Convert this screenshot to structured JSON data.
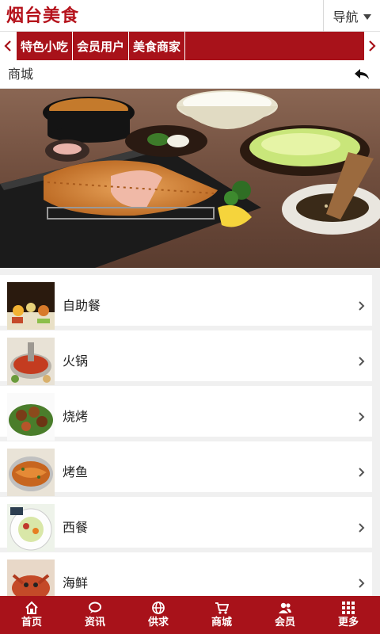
{
  "header": {
    "logo_text": "烟台美食",
    "nav_label": "导航"
  },
  "category_bar": {
    "items": [
      {
        "label": "特色小吃"
      },
      {
        "label": "会员用户"
      },
      {
        "label": "美食商家"
      }
    ]
  },
  "section": {
    "title": "商城"
  },
  "list": {
    "items": [
      {
        "label": "自助餐",
        "icon": "buffet-thumbnail"
      },
      {
        "label": "火锅",
        "icon": "hotpot-thumbnail"
      },
      {
        "label": "烧烤",
        "icon": "bbq-thumbnail"
      },
      {
        "label": "烤鱼",
        "icon": "grilled-fish-thumbnail"
      },
      {
        "label": "西餐",
        "icon": "western-food-thumbnail"
      },
      {
        "label": "海鲜",
        "icon": "seafood-thumbnail"
      }
    ]
  },
  "bottom_nav": {
    "items": [
      {
        "label": "首页",
        "icon": "home-icon"
      },
      {
        "label": "资讯",
        "icon": "chat-bubble-icon"
      },
      {
        "label": "供求",
        "icon": "globe-icon"
      },
      {
        "label": "商城",
        "icon": "cart-icon"
      },
      {
        "label": "会员",
        "icon": "users-icon"
      },
      {
        "label": "更多",
        "icon": "grid-icon"
      }
    ]
  },
  "colors": {
    "brand_red": "#a8121a",
    "logo_red": "#b5121b",
    "background": "#f0f0f0"
  }
}
